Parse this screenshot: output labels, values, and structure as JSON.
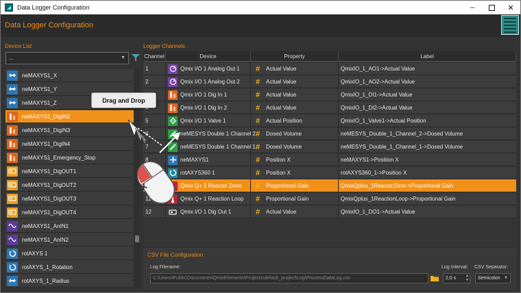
{
  "window": {
    "title": "Data Logger Configuration",
    "minimize": "–",
    "close": "✕"
  },
  "header": {
    "title": "Data Logger Configuration"
  },
  "device_panel": {
    "label": "Device List",
    "filter_value": "...",
    "items": [
      {
        "label": "neMAXYS1_X",
        "icon": "axis-arrow-icon",
        "color": "blue"
      },
      {
        "label": "neMAXYS1_Y",
        "icon": "axis-arrow-icon",
        "color": "blue"
      },
      {
        "label": "neMAXYS1_Z",
        "icon": "axis-arrow-icon",
        "color": "blue"
      },
      {
        "label": "neMAXYS1_DigIN2",
        "icon": "digital-in-icon",
        "color": "orange",
        "selected": true
      },
      {
        "label": "neMAXYS1_DigIN3",
        "icon": "digital-in-icon",
        "color": "orange"
      },
      {
        "label": "neMAXYS1_DigIN4",
        "icon": "digital-in-icon",
        "color": "orange"
      },
      {
        "label": "neMAXYS1_Emergency_Stop",
        "icon": "digital-in-icon",
        "color": "orange"
      },
      {
        "label": "neMAXYS1_DigOUT1",
        "icon": "digital-out-icon",
        "color": "yellow"
      },
      {
        "label": "neMAXYS1_DigOUT2",
        "icon": "digital-out-icon",
        "color": "yellow"
      },
      {
        "label": "neMAXYS1_DigOUT3",
        "icon": "digital-out-icon",
        "color": "yellow"
      },
      {
        "label": "neMAXYS1_DigOUT4",
        "icon": "digital-out-icon",
        "color": "yellow"
      },
      {
        "label": "neMAXYS1_AnIN1",
        "icon": "analog-in-icon",
        "color": "purple"
      },
      {
        "label": "neMAXYS1_AnIN2",
        "icon": "analog-in-icon",
        "color": "purple"
      },
      {
        "label": "rotAXYS 1",
        "icon": "rotation-icon",
        "color": "blue"
      },
      {
        "label": "rotAXYS_1_Rotation",
        "icon": "rotation-icon",
        "color": "blue"
      },
      {
        "label": "rotAXYS_1_Radius",
        "icon": "axis-arrow-icon",
        "color": "blue"
      }
    ]
  },
  "channels_panel": {
    "label": "Logger Channels",
    "columns": [
      "Channel",
      "Device",
      "Property",
      "Label"
    ],
    "rows": [
      {
        "channel": "1",
        "device": "Qmix I/O 1 Analog Out 1",
        "icon": "analog-out-icon",
        "color": "purple",
        "property": "Actual Value",
        "label": "QmixIO_1_AO1->Actual Value"
      },
      {
        "channel": "2",
        "device": "Qmix I/O 1 Analog Out 2",
        "icon": "analog-out-icon",
        "color": "purple",
        "property": "Actual Value",
        "label": "QmixIO_1_AO2->Actual Value"
      },
      {
        "channel": "3",
        "device": "Qmix I/O 1 Dig In 1",
        "icon": "digital-in-icon",
        "color": "orange",
        "property": "Actual Value",
        "label": "QmixIO_1_DI1->Actual Value"
      },
      {
        "channel": "4",
        "device": "Qmix I/O 1 Dig In 2",
        "icon": "digital-in-icon",
        "color": "orange",
        "property": "Actual Value",
        "label": "QmixIO_1_DI2->Actual Value"
      },
      {
        "channel": "5",
        "device": "Qmix I/O 1 Valve 1",
        "icon": "valve-icon",
        "color": "green",
        "property": "Actual Position",
        "label": "QmixIO_1_Valve1->Actual Position"
      },
      {
        "channel": "6",
        "device": "neMESYS Double 1 Channel 2",
        "icon": "syringe-icon",
        "color": "green",
        "property": "Dosed Volume",
        "label": "neMESYS_Double_1_Channel_2->Dosed Volume"
      },
      {
        "channel": "7",
        "device": "neMESYS Double 1 Channel 1",
        "icon": "syringe-icon",
        "color": "green",
        "property": "Dosed Volume",
        "label": "neMESYS_Double_1_Channel_1->Dosed Volume"
      },
      {
        "channel": "8",
        "device": "neMAXYS1",
        "icon": "axis-icon",
        "color": "blue",
        "property": "Position X",
        "label": "neMAXYS1->Position X"
      },
      {
        "channel": "9",
        "device": "rotAXYS360 1",
        "icon": "rotation-icon",
        "color": "teal",
        "property": "Position X",
        "label": "rotAXYS360_1->Position X"
      },
      {
        "channel": "10",
        "device": "Qmix Q+ 1 Reactor Zone",
        "icon": "thermometer-icon",
        "color": "red",
        "property": "Proportional Gain",
        "label": "QmixQplus_1ReactorZone->Proportional Gain",
        "selected": true
      },
      {
        "channel": "11",
        "device": "Qmix Q+ 1 Reaction Loop",
        "icon": "thermometer-icon",
        "color": "red",
        "property": "Proportional Gain",
        "label": "QmixQplus_1ReactionLoop->Proportional Gain"
      },
      {
        "channel": "12",
        "device": "Qmix I/O 1 Dig Out 1",
        "icon": "digital-out-icon",
        "color": "yellow",
        "property": "Actual Value",
        "label": "QmixIO_1_DO1->Actual Value"
      }
    ]
  },
  "csv_panel": {
    "title": "CSV File Configuration",
    "filename_label": "Log Filename:",
    "filename_value": "C:\\Users\\Public\\Documents\\QmixElements\\Projects\\default_project\\Log\\ProcessDataLog.csv",
    "interval_label": "Log Interval:",
    "interval_value": "2,0 s",
    "separator_label": "CSV Separator:",
    "separator_value": "Semicolon"
  },
  "overlay": {
    "tooltip": "Drag and Drop",
    "mouse_count": "1x"
  },
  "colors": {
    "accent": "#f2911a",
    "title_orange": "#f08c1e",
    "background": "#333333"
  }
}
